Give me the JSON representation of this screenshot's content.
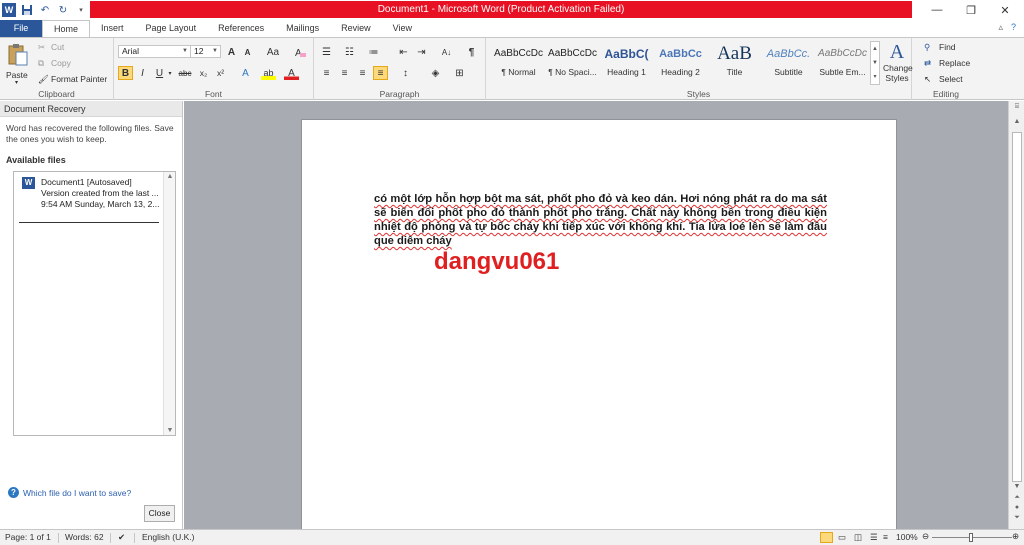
{
  "window": {
    "title": "Document1 - Microsoft Word (Product Activation Failed)",
    "minimize": "—",
    "restore": "❐",
    "close": "✕"
  },
  "qat": {
    "undo": "↶",
    "redo": "↻"
  },
  "tabs": [
    {
      "label": "File"
    },
    {
      "label": "Home"
    },
    {
      "label": "Insert"
    },
    {
      "label": "Page Layout"
    },
    {
      "label": "References"
    },
    {
      "label": "Mailings"
    },
    {
      "label": "Review"
    },
    {
      "label": "View"
    }
  ],
  "ribbon": {
    "clipboard": {
      "label": "Clipboard",
      "paste": "Paste",
      "cut": "Cut",
      "copy": "Copy",
      "format_painter": "Format Painter"
    },
    "font": {
      "label": "Font",
      "font_name": "Arial",
      "font_size": "12",
      "grow": "A",
      "shrink": "A",
      "change_case": "Aa",
      "bold": "B",
      "italic": "I",
      "underline": "U",
      "strike": "abc",
      "subscript": "x₂",
      "superscript": "x²",
      "text_effects": "A",
      "highlight": "ab",
      "font_color": "A"
    },
    "paragraph": {
      "label": "Paragraph",
      "pilcrow": "¶",
      "sort": "A↓"
    },
    "styles": {
      "label": "Styles",
      "items": [
        {
          "sample": "AaBbCcDc",
          "name": "¶ Normal"
        },
        {
          "sample": "AaBbCcDc",
          "name": "¶ No Spaci..."
        },
        {
          "sample": "AaBbC(",
          "name": "Heading 1"
        },
        {
          "sample": "AaBbCc",
          "name": "Heading 2"
        },
        {
          "sample": "AaB",
          "name": "Title"
        },
        {
          "sample": "AaBbCc.",
          "name": "Subtitle"
        },
        {
          "sample": "AaBbCcDc",
          "name": "Subtle Em..."
        }
      ],
      "change_styles": "Change Styles"
    },
    "editing": {
      "label": "Editing",
      "find": "Find",
      "replace": "Replace",
      "select": "Select"
    }
  },
  "recovery": {
    "title": "Document Recovery",
    "message": "Word has recovered the following files.  Save the ones you wish to keep.",
    "available_label": "Available files",
    "file": {
      "icon": "W",
      "name": "Document1  [Autosaved]",
      "line2": "Version created from the last ...",
      "line3": "9:54 AM Sunday, March 13, 2..."
    },
    "help_link": "Which file do I want to save?",
    "close_button": "Close"
  },
  "document": {
    "body": "có một lớp hỗn hợp bột ma sát, phốt pho đỏ và keo dán. Hơi nóng phát ra do ma sát sẽ biến đổi phốt pho đỏ thành phốt pho trắng. Chất này không bền trong điều kiện nhiệt độ phòng và tự bốc cháy khi tiếp xúc với không khí. Tia lửa loé lên sẽ làm đầu que diêm cháy",
    "watermark": "dangvu061"
  },
  "statusbar": {
    "page": "Page: 1 of 1",
    "words": "Words: 62",
    "language": "English (U.K.)",
    "zoom": "100%",
    "zoom_out": "⊖",
    "zoom_in": "⊕"
  },
  "colors": {
    "title_bar_alert": "#e81123",
    "file_tab": "#2b579a",
    "watermark": "#e02020"
  }
}
